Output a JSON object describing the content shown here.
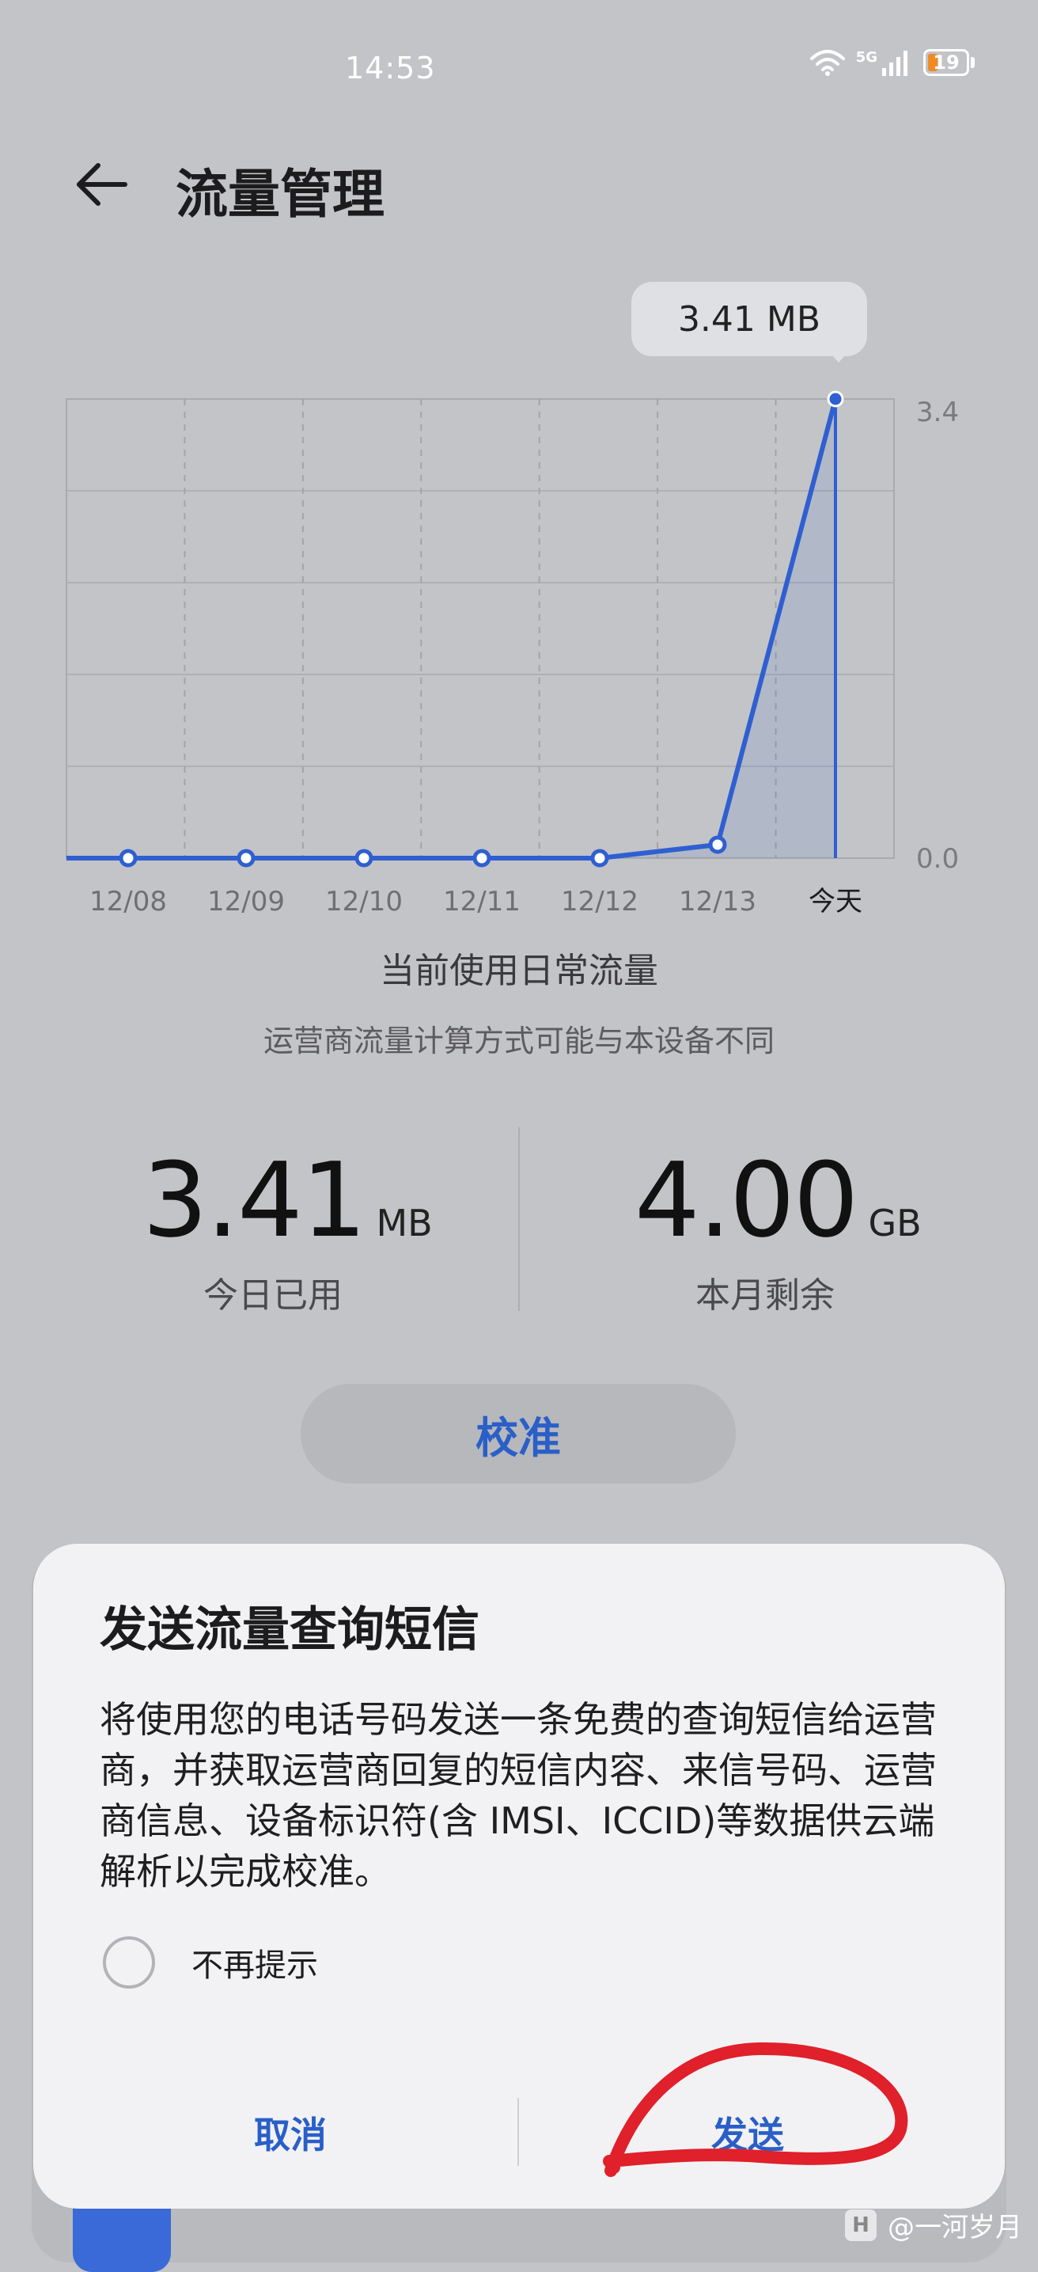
{
  "status_bar": {
    "time": "14:53",
    "network": "5G",
    "battery": "19"
  },
  "header": {
    "title": "流量管理"
  },
  "chart_data": {
    "type": "line",
    "categories": [
      "12/08",
      "12/09",
      "12/10",
      "12/11",
      "12/12",
      "12/13",
      "今天"
    ],
    "series": [
      {
        "values": [
          0,
          0,
          0,
          0,
          0,
          0.1,
          3.41
        ]
      }
    ],
    "y_ticks": [
      "3.4",
      "0.0"
    ],
    "ylim": [
      0,
      3.41
    ],
    "highlight_label": "3.41 MB",
    "grid": true,
    "color": "#2f5fd0"
  },
  "summary": {
    "title": "当前使用日常流量",
    "note": "运营商流量计算方式可能与本设备不同",
    "used_value": "3.41",
    "used_unit": "MB",
    "used_label": "今日已用",
    "remaining_value": "4.00",
    "remaining_unit": "GB",
    "remaining_label": "本月剩余",
    "calibrate_label": "校准"
  },
  "dialog": {
    "title": "发送流量查询短信",
    "body": "将使用您的电话号码发送一条免费的查询短信给运营商，并获取运营商回复的短信内容、来信号码、运营商信息、设备标识符(含 IMSI、ICCID)等数据供云端解析以完成校准。",
    "dont_remind_label": "不再提示",
    "cancel_label": "取消",
    "send_label": "发送"
  },
  "watermark": {
    "logo": "H",
    "text": "@一河岁月"
  },
  "colors": {
    "accent": "#2a5fc8",
    "annotation": "#e0202a"
  }
}
